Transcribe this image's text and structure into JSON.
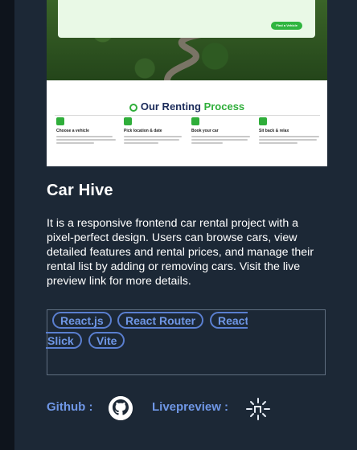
{
  "project": {
    "preview": {
      "hero_button": "Find a Vehicle",
      "heading_part1": "Our Renting",
      "heading_part2": "Process",
      "steps": [
        {
          "title": "Choose a vehicle"
        },
        {
          "title": "Pick location & date"
        },
        {
          "title": "Book your car"
        },
        {
          "title": "Sit back & relax"
        }
      ]
    },
    "title": "Car Hive",
    "description": "It is a responsive frontend car rental project with a pixel-perfect design. Users can browse cars, view detailed features and rental prices, and manage their rental list by adding or removing cars. Visit the live preview link for more details.",
    "tags": [
      "React.js",
      "React Router",
      "React",
      "Slick",
      "Vite"
    ],
    "links": {
      "github_label": "Github :",
      "github_icon": "github-icon",
      "livepreview_label": "Livepreview :",
      "livepreview_icon": "live-preview-icon"
    }
  },
  "colors": {
    "page_bg": "#0e141c",
    "card_bg": "#1c2836",
    "accent_blue": "#6f97e6",
    "accent_green": "#2fae3a"
  }
}
